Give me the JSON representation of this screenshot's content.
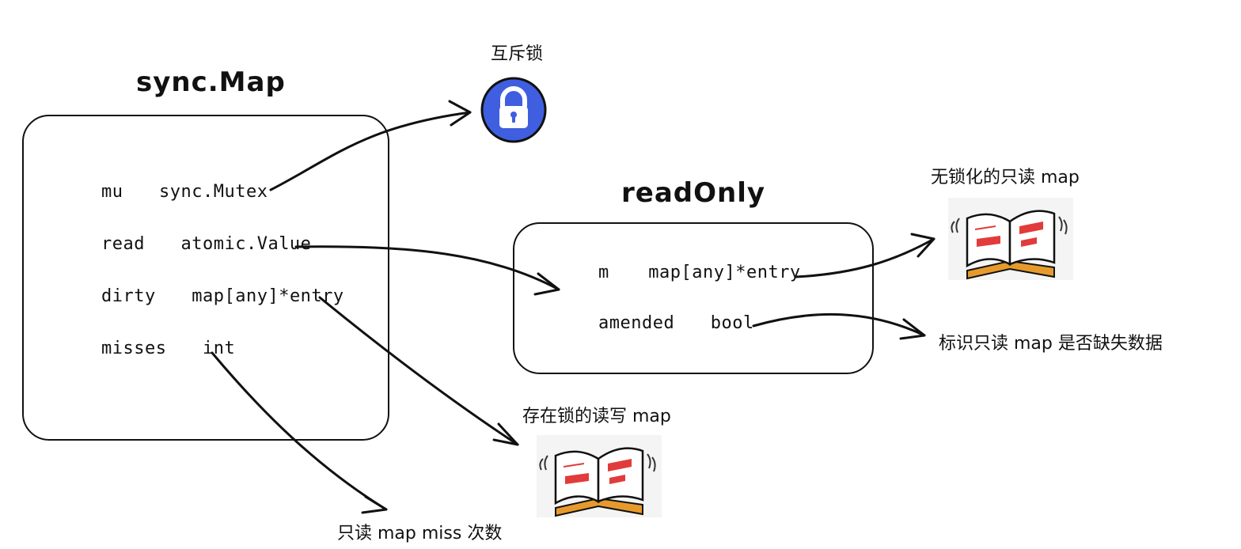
{
  "syncmap": {
    "title": "sync.Map",
    "fields": [
      {
        "name": "mu",
        "type": "sync.Mutex"
      },
      {
        "name": "read",
        "type": "atomic.Value"
      },
      {
        "name": "dirty",
        "type": "map[any]*entry"
      },
      {
        "name": "misses",
        "type": "int"
      }
    ]
  },
  "readonly": {
    "title": "readOnly",
    "fields": [
      {
        "name": "m",
        "type": "map[any]*entry"
      },
      {
        "name": "amended",
        "type": "bool"
      }
    ]
  },
  "labels": {
    "mutex": "互斥锁",
    "lockfree_map": "无锁化的只读 map",
    "amended_desc": "标识只读 map 是否缺失数据",
    "locked_map": "存在锁的读写 map",
    "misses_desc": "只读 map miss 次数"
  },
  "icons": {
    "lock": "lock-icon",
    "book": "open-book-icon"
  },
  "colors": {
    "lock_blue": "#3f5fe0",
    "book_red": "#e23b3b",
    "book_orange": "#e79a2c"
  }
}
